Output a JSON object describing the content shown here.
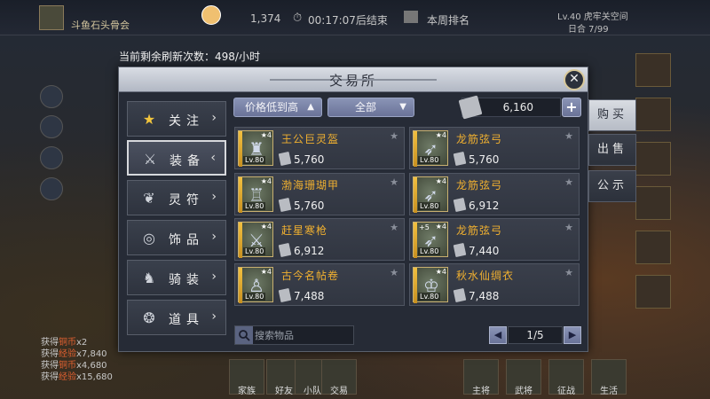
{
  "hud": {
    "guild_name": "斗鱼石头骨会",
    "power": "1,374",
    "timer": "00:17:07后结束",
    "weekly_rank": "本周排名",
    "level_line": "Lv.40 虎牢关空间",
    "level_sub": "日合  7/99"
  },
  "refresh_notice": "当前剩余刷新次数：498/小时",
  "panel": {
    "title": "交易所",
    "close_label": "✕"
  },
  "categories": [
    {
      "label": "关注",
      "icon": "star-icon",
      "glyph": "★"
    },
    {
      "label": "装备",
      "icon": "armor-icon",
      "glyph": "⚔"
    },
    {
      "label": "灵符",
      "icon": "talisman-icon",
      "glyph": "❦"
    },
    {
      "label": "饰品",
      "icon": "ring-icon",
      "glyph": "◎"
    },
    {
      "label": "骑装",
      "icon": "mount-gear-icon",
      "glyph": "♞"
    },
    {
      "label": "道具",
      "icon": "tool-icon",
      "glyph": "❂"
    }
  ],
  "active_category_arrow": "‹",
  "inactive_category_arrow": "›",
  "filters": {
    "sort_label": "价格低到高",
    "sort_caret": "▲",
    "type_label": "全部",
    "type_caret": "▼",
    "currency_value": "6,160",
    "add_label": "+"
  },
  "items": [
    {
      "name": "王公巨灵盔",
      "price": "5,760",
      "level": "Lv.80",
      "stars": "★4",
      "plus": ""
    },
    {
      "name": "龙筋弦弓",
      "price": "5,760",
      "level": "Lv.80",
      "stars": "★4",
      "plus": ""
    },
    {
      "name": "渤海珊瑚甲",
      "price": "5,760",
      "level": "Lv.80",
      "stars": "★4",
      "plus": ""
    },
    {
      "name": "龙筋弦弓",
      "price": "6,912",
      "level": "Lv.80",
      "stars": "★4",
      "plus": ""
    },
    {
      "name": "赶星寒枪",
      "price": "6,912",
      "level": "Lv.80",
      "stars": "★4",
      "plus": ""
    },
    {
      "name": "龙筋弦弓",
      "price": "7,440",
      "level": "Lv.80",
      "stars": "★4",
      "plus": "+5"
    },
    {
      "name": "古今名帖卷",
      "price": "7,488",
      "level": "Lv.80",
      "stars": "★4",
      "plus": ""
    },
    {
      "name": "秋水仙绸衣",
      "price": "7,488",
      "level": "Lv.80",
      "stars": "★4",
      "plus": ""
    }
  ],
  "search": {
    "placeholder": "搜索物品"
  },
  "pager": {
    "prev": "◀",
    "value": "1/5",
    "next": "▶"
  },
  "side_tabs": [
    {
      "label": "购买",
      "active": true
    },
    {
      "label": "出售",
      "active": false
    },
    {
      "label": "公示",
      "active": false
    }
  ],
  "chat": [
    {
      "prefix": "获得",
      "tag": "铜币",
      "value": "x2"
    },
    {
      "prefix": "获得",
      "tag": "经验",
      "value": "x7,840"
    },
    {
      "prefix": "获得",
      "tag": "铜币",
      "value": "x4,680"
    },
    {
      "prefix": "获得",
      "tag": "经验",
      "value": "x15,680"
    }
  ],
  "bottom_buttons": [
    "家族",
    "好友",
    "小队",
    "交易",
    "主将",
    "武将",
    "征战",
    "生活"
  ]
}
